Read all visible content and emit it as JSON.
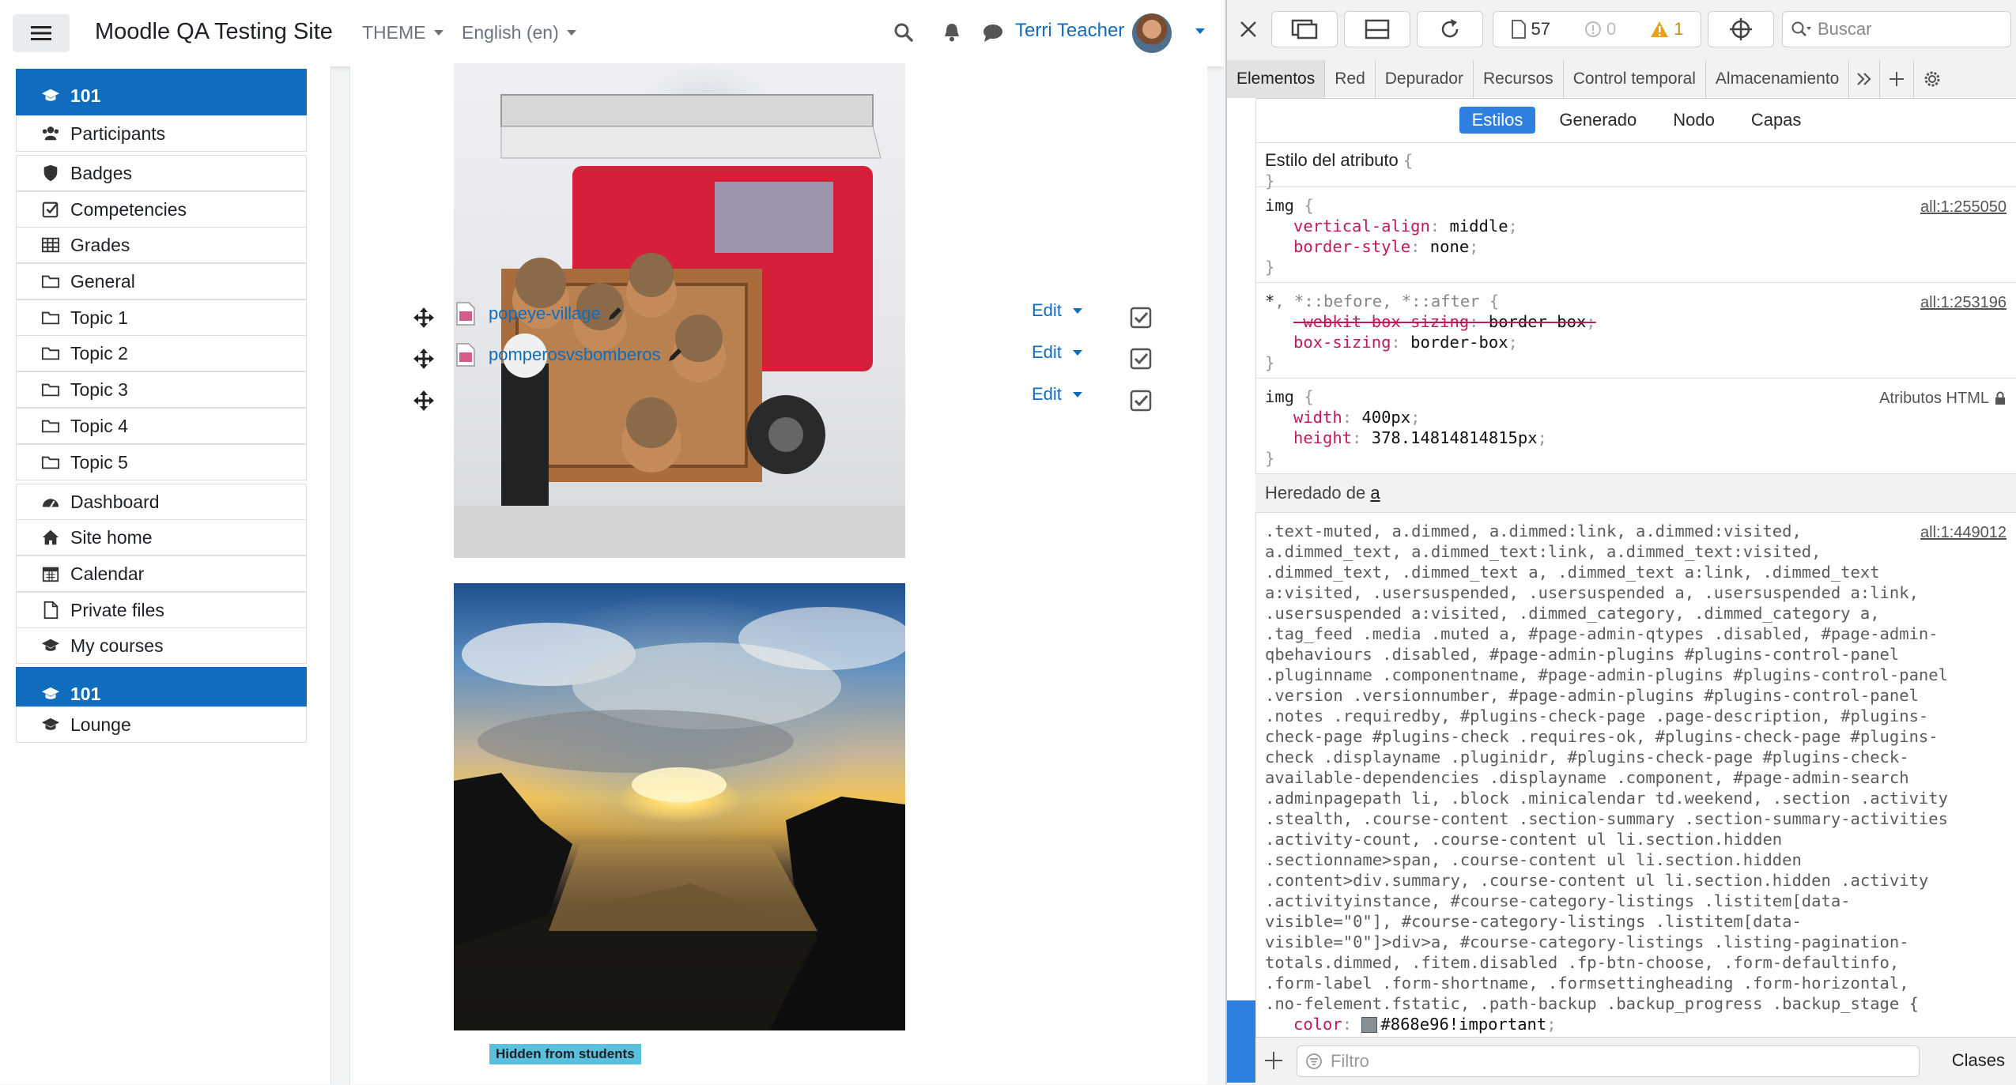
{
  "moodle": {
    "site_name": "Moodle QA Testing Site",
    "theme_menu": "THEME",
    "language_menu": "English (en)",
    "user_name": "Terri Teacher",
    "nav": [
      {
        "label": "101",
        "icon": "graduation-cap-icon",
        "active": true
      },
      {
        "label": "Participants",
        "icon": "users-icon"
      },
      {
        "label": "Badges",
        "icon": "shield-icon"
      },
      {
        "label": "Competencies",
        "icon": "check-square-icon"
      },
      {
        "label": "Grades",
        "icon": "table-icon"
      },
      {
        "label": "General",
        "icon": "folder-icon"
      },
      {
        "label": "Topic 1",
        "icon": "folder-icon"
      },
      {
        "label": "Topic 2",
        "icon": "folder-icon"
      },
      {
        "label": "Topic 3",
        "icon": "folder-icon"
      },
      {
        "label": "Topic 4",
        "icon": "folder-icon"
      },
      {
        "label": "Topic 5",
        "icon": "folder-icon"
      },
      {
        "label": "Dashboard",
        "icon": "dashboard-icon"
      },
      {
        "label": "Site home",
        "icon": "home-icon"
      },
      {
        "label": "Calendar",
        "icon": "calendar-icon"
      },
      {
        "label": "Private files",
        "icon": "file-icon"
      },
      {
        "label": "My courses",
        "icon": "graduation-cap-icon"
      },
      {
        "label": "101",
        "icon": "graduation-cap-icon",
        "active": true
      },
      {
        "label": "Lounge",
        "icon": "graduation-cap-icon"
      }
    ],
    "activities": [
      {
        "name": "popeye-village",
        "edit_label": "Edit"
      },
      {
        "name": "pomperosvsbomberos",
        "edit_label": "Edit"
      },
      {
        "name": "",
        "edit_label": "Edit"
      }
    ],
    "hidden_badge": "Hidden from students"
  },
  "devtools": {
    "search_placeholder": "Buscar",
    "resource_count": "57",
    "error_count": "0",
    "warning_count": "1",
    "tabs": [
      "Elementos",
      "Red",
      "Depurador",
      "Recursos",
      "Control temporal",
      "Almacenamiento"
    ],
    "active_tab": "Elementos",
    "subtabs": [
      "Estilos",
      "Generado",
      "Nodo",
      "Capas"
    ],
    "active_subtab": "Estilos",
    "attr_style_title": "Estilo del atributo",
    "rule1": {
      "selector": "img",
      "source": "all:1:255050",
      "props": [
        [
          "vertical-align",
          "middle"
        ],
        [
          "border-style",
          "none"
        ]
      ]
    },
    "rule2": {
      "selector": "*",
      "selector_extra": ", *::before, *::after",
      "source": "all:1:253196",
      "props": [
        [
          "-webkit-box-sizing",
          "border-box"
        ],
        [
          "box-sizing",
          "border-box"
        ]
      ]
    },
    "rule3": {
      "selector": "img",
      "source": "Atributos HTML",
      "props": [
        [
          "width",
          "400px"
        ],
        [
          "height",
          "378.14814814815px"
        ]
      ]
    },
    "inherited_label": "Heredado de",
    "inherited_from": "a",
    "rule4": {
      "source": "all:1:449012",
      "selector": ".text-muted, a.dimmed, a.dimmed:link, a.dimmed:visited,\na.dimmed_text, a.dimmed_text:link, a.dimmed_text:visited,\n.dimmed_text, .dimmed_text a, .dimmed_text a:link, .dimmed_text\na:visited, .usersuspended, .usersuspended a, .usersuspended a:link,\n.usersuspended a:visited, .dimmed_category, .dimmed_category a,\n.tag_feed .media .muted a, #page-admin-qtypes .disabled, #page-admin-\nqbehaviours .disabled, #page-admin-plugins #plugins-control-panel\n.pluginname .componentname, #page-admin-plugins #plugins-control-panel\n.version .versionnumber, #page-admin-plugins #plugins-control-panel\n.notes .requiredby, #plugins-check-page .page-description, #plugins-\ncheck-page #plugins-check .requires-ok, #plugins-check-page #plugins-\ncheck .displayname .pluginidr, #plugins-check-page #plugins-check-\navailable-dependencies .displayname .component, #page-admin-search\n.adminpagepath li, .block .minicalendar td.weekend, .section .activity\n.stealth, .course-content .section-summary .section-summary-activities\n.activity-count, .course-content ul li.section.hidden\n.sectionname>span, .course-content ul li.section.hidden\n.content>div.summary, .course-content ul li.section.hidden .activity\n.activityinstance, #course-category-listings .listitem[data-\nvisible=\"0\"], #course-category-listings .listitem[data-\nvisible=\"0\"]>div>a, #course-category-listings .listing-pagination-\ntotals.dimmed, .fitem.disabled .fp-btn-choose, .form-defaultinfo,\n.form-label .form-shortname, .formsettingheading .form-horizontal,\n.no-felement.fstatic, .path-backup .backup_progress .backup_stage {",
      "prop": "color",
      "value": "#868e96!important",
      "swatch_color": "#868e96"
    },
    "filter_placeholder": "Filtro",
    "classes_label": "Clases"
  }
}
